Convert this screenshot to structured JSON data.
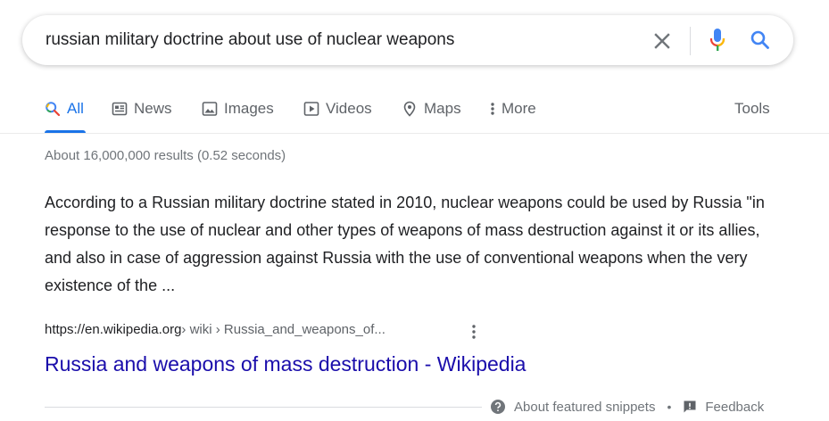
{
  "search": {
    "query": "russian military doctrine about use of nuclear weapons"
  },
  "tabs": [
    {
      "label": "All",
      "icon": "search-icon",
      "active": true
    },
    {
      "label": "News",
      "icon": "news-icon"
    },
    {
      "label": "Images",
      "icon": "image-icon"
    },
    {
      "label": "Videos",
      "icon": "video-icon"
    },
    {
      "label": "Maps",
      "icon": "map-pin-icon"
    },
    {
      "label": "More",
      "icon": "more-vert-icon"
    }
  ],
  "tools_label": "Tools",
  "result_stats": "About 16,000,000 results (0.52 seconds)",
  "featured_snippet": {
    "text": "According to a Russian military doctrine stated in 2010, nuclear weapons could be used by Russia \"in response to the use of nuclear and other types of weapons of mass destruction against it or its allies, and also in case of aggression against Russia with the use of conventional weapons when the very existence of the ...",
    "cite_domain": "https://en.wikipedia.org",
    "cite_path": " › wiki › Russia_and_weapons_of...",
    "title": "Russia and weapons of mass destruction - Wikipedia"
  },
  "footer": {
    "about_label": "About featured snippets",
    "separator": "•",
    "feedback_label": "Feedback"
  },
  "colors": {
    "accent": "#1a73e8",
    "link": "#1a0dab",
    "muted": "#70757a",
    "text": "#202124"
  }
}
